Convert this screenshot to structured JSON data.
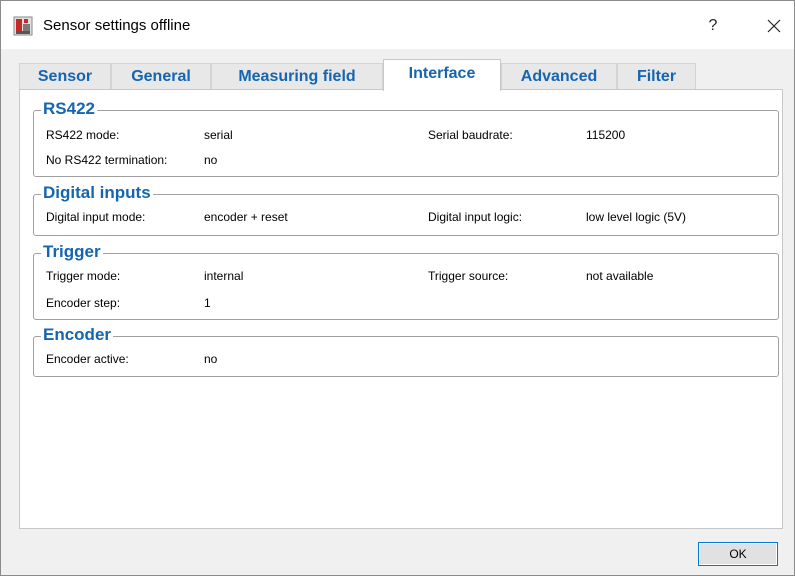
{
  "window": {
    "title": "Sensor settings offline"
  },
  "titlebar": {
    "help_label": "?",
    "close_icon": "close-icon",
    "app_icon": "sensor-app-icon"
  },
  "tabs": [
    {
      "label": "Sensor",
      "active": false
    },
    {
      "label": "General",
      "active": false
    },
    {
      "label": "Measuring field",
      "active": false
    },
    {
      "label": "Interface",
      "active": true
    },
    {
      "label": "Advanced",
      "active": false
    },
    {
      "label": "Filter",
      "active": false
    }
  ],
  "groups": {
    "rs422": {
      "title": "RS422",
      "rows": [
        {
          "label": "RS422 mode:",
          "value": "serial",
          "label2": "Serial baudrate:",
          "value2": "115200"
        },
        {
          "label": "No RS422 termination:",
          "value": "no"
        }
      ]
    },
    "digital_inputs": {
      "title": "Digital inputs",
      "rows": [
        {
          "label": "Digital input mode:",
          "value": "encoder + reset",
          "label2": "Digital input logic:",
          "value2": "low level logic (5V)"
        }
      ]
    },
    "trigger": {
      "title": "Trigger",
      "rows": [
        {
          "label": "Trigger mode:",
          "value": "internal",
          "label2": "Trigger source:",
          "value2": "not available"
        },
        {
          "label": "Encoder step:",
          "value": "1"
        }
      ]
    },
    "encoder": {
      "title": "Encoder",
      "rows": [
        {
          "label": "Encoder active:",
          "value": "no"
        }
      ]
    }
  },
  "footer": {
    "ok_label": "OK"
  },
  "colors": {
    "accent": "#1565b0",
    "ok_border": "#0078d7",
    "app_icon_red": "#c62828"
  }
}
